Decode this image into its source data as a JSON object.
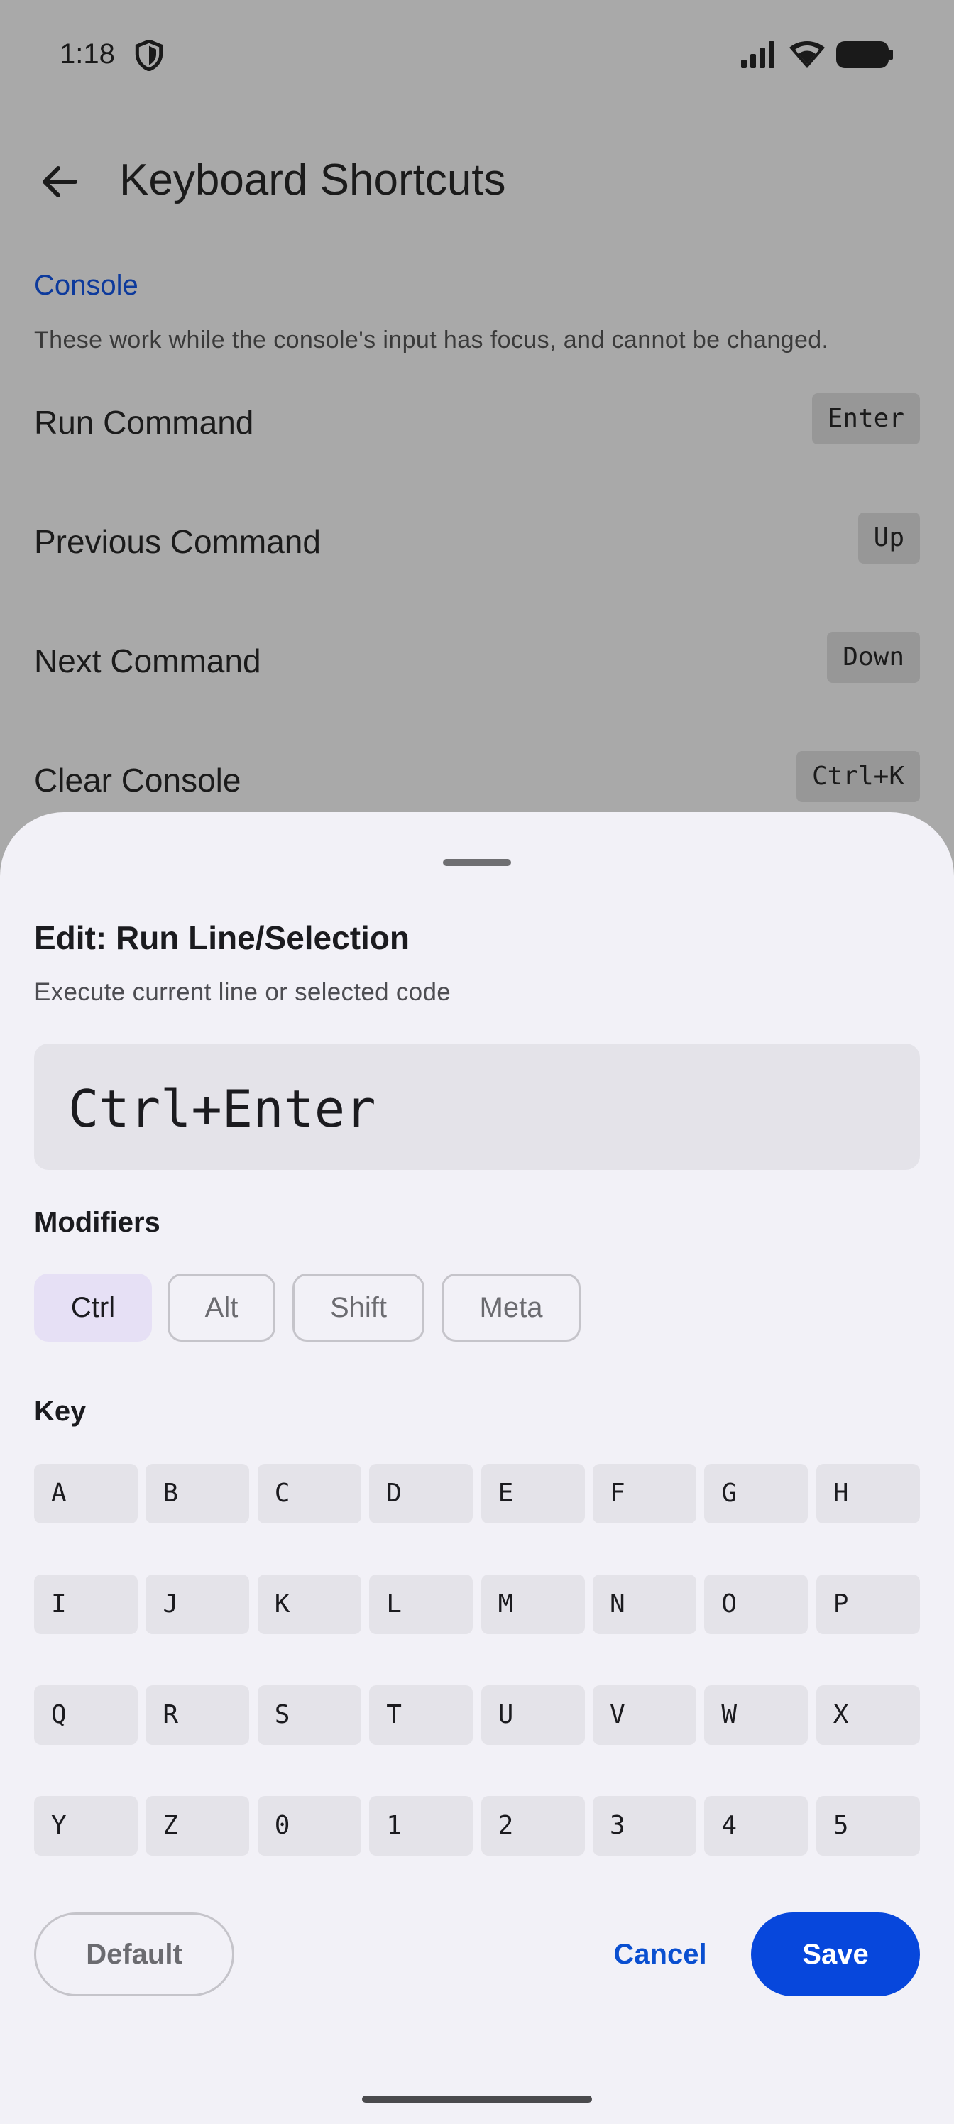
{
  "status_bar": {
    "time": "1:18"
  },
  "top_bar": {
    "title": "Keyboard Shortcuts"
  },
  "section": {
    "header": "Console",
    "description": "These work while the console's input has focus, and cannot be changed."
  },
  "shortcuts": [
    {
      "label": "Run Command",
      "key": "Enter"
    },
    {
      "label": "Previous Command",
      "key": "Up"
    },
    {
      "label": "Next Command",
      "key": "Down"
    },
    {
      "label": "Clear Console",
      "key": "Ctrl+K"
    }
  ],
  "sheet": {
    "title": "Edit: Run Line/Selection",
    "subtitle": "Execute current line or selected code",
    "combo": "Ctrl+Enter",
    "modifiers_label": "Modifiers",
    "modifiers": [
      {
        "label": "Ctrl",
        "selected": true
      },
      {
        "label": "Alt",
        "selected": false
      },
      {
        "label": "Shift",
        "selected": false
      },
      {
        "label": "Meta",
        "selected": false
      }
    ],
    "key_label": "Key",
    "keys": [
      "A",
      "B",
      "C",
      "D",
      "E",
      "F",
      "G",
      "H",
      "I",
      "J",
      "K",
      "L",
      "M",
      "N",
      "O",
      "P",
      "Q",
      "R",
      "S",
      "T",
      "U",
      "V",
      "W",
      "X",
      "Y",
      "Z",
      "0",
      "1",
      "2",
      "3",
      "4",
      "5"
    ],
    "buttons": {
      "default": "Default",
      "cancel": "Cancel",
      "save": "Save"
    }
  },
  "colors": {
    "accent": "#0747dc",
    "section_header": "#0d3a9c",
    "chip_selected": "#e6e0f5",
    "scrim": "#a9a9a9"
  }
}
